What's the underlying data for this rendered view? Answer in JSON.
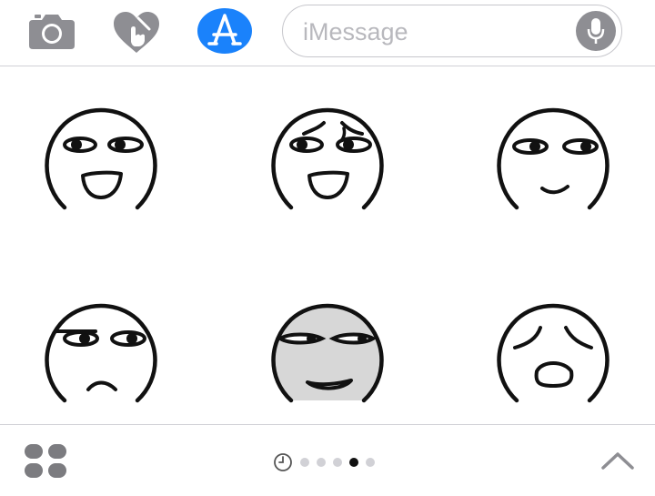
{
  "input": {
    "placeholder": "iMessage"
  },
  "toolbar": {
    "icons": [
      "camera-icon",
      "digital-touch-icon",
      "app-store-icon",
      "microphone-icon"
    ],
    "accent": "#1a82fb",
    "icon_color": "#8e8e93"
  },
  "stickers": [
    {
      "name": "laughing-face"
    },
    {
      "name": "smug-laughing-face"
    },
    {
      "name": "sly-smile-face"
    },
    {
      "name": "frowning-face"
    },
    {
      "name": "grey-smirk-face"
    },
    {
      "name": "distressed-face"
    }
  ],
  "pager": {
    "page_count": 5,
    "active_page": 4
  }
}
